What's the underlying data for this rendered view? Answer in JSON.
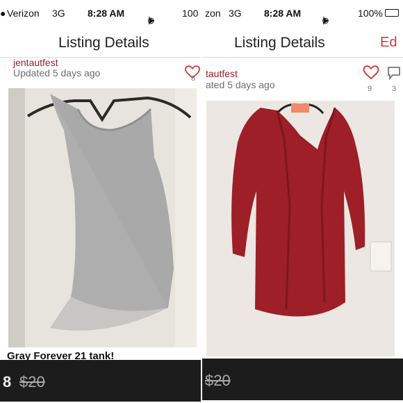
{
  "colors": {
    "accent": "#d03a3a",
    "seller": "#9a1f2a",
    "pricebar": "#1c1c1c"
  },
  "left": {
    "status": {
      "carrier": "Verizon",
      "network": "3G",
      "time": "8:28 AM",
      "battery": "100"
    },
    "nav": {
      "title": "Listing Details"
    },
    "listing": {
      "seller": "jentautfest",
      "updated": "Updated 5 days ago",
      "likes": "8",
      "title": "Gray Forever 21 tank!",
      "price": "8",
      "original_price": "$20"
    }
  },
  "right": {
    "status": {
      "carrier": "zon",
      "network": "3G",
      "time": "8:28 AM",
      "battery": "100%"
    },
    "nav": {
      "title": "Listing Details",
      "action": "Ed"
    },
    "listing": {
      "seller": "tautfest",
      "updated": "ated 5 days ago",
      "likes": "9",
      "comments": "3",
      "original_price": "$20"
    }
  }
}
